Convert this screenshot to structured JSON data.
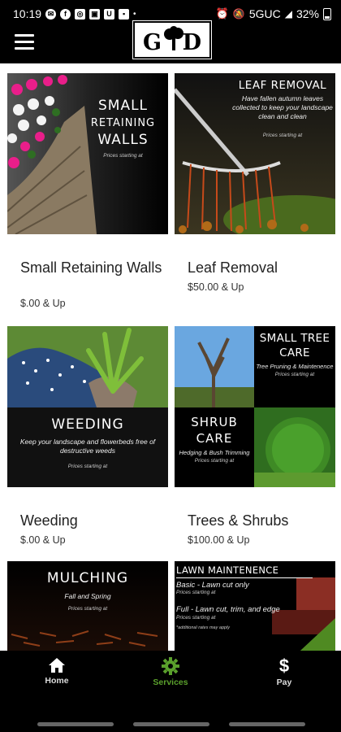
{
  "status_bar": {
    "time": "10:19",
    "network": "5GUC",
    "battery": "32%"
  },
  "logo": {
    "left_letter": "G",
    "right_letter": "D"
  },
  "services": [
    {
      "name": "Small Retaining Walls",
      "price": "$.00 & Up",
      "thumb_title_lines": [
        "SMALL",
        "RETAINING",
        "WALLS"
      ],
      "thumb_note": "Prices starting at"
    },
    {
      "name": "Leaf Removal",
      "price": "$50.00 & Up",
      "thumb_title": "LEAF REMOVAL",
      "thumb_sub": "Have fallen autumn leaves collected to keep your landscape clean and clean",
      "thumb_note": "Prices starting at"
    },
    {
      "name": "Weeding",
      "price": "$.00 & Up",
      "thumb_title": "WEEDING",
      "thumb_sub": "Keep your landscape and flowerbeds free of destructive weeds",
      "thumb_note": "Prices starting at"
    },
    {
      "name": "Trees & Shrubs",
      "price": "$100.00 & Up",
      "thumb_title_a": "SMALL TREE CARE",
      "thumb_sub_a": "Tree Pruning & Maintenence",
      "thumb_note_a": "Prices starting at",
      "thumb_title_b": "SHRUB CARE",
      "thumb_sub_b": "Hedging & Bush Trimming",
      "thumb_note_b": "Prices starting at"
    },
    {
      "name": "Mulching",
      "price": "",
      "thumb_title": "MULCHING",
      "thumb_sub": "Fall and Spring",
      "thumb_note": "Prices starting at"
    },
    {
      "name": "Lawn Maintenence",
      "price": "",
      "thumb_title": "LAWN MAINTENENCE",
      "thumb_line1": "Basic - Lawn cut only",
      "thumb_note1": "Prices starting at",
      "thumb_line2": "Full - Lawn cut, trim, and edge",
      "thumb_note2": "Prices starting at",
      "thumb_foot": "*additional rates may apply"
    }
  ],
  "nav": {
    "home": "Home",
    "services": "Services",
    "pay": "Pay"
  },
  "colors": {
    "active": "#5aa02c",
    "background": "#000000",
    "grid": "#ffffff"
  }
}
